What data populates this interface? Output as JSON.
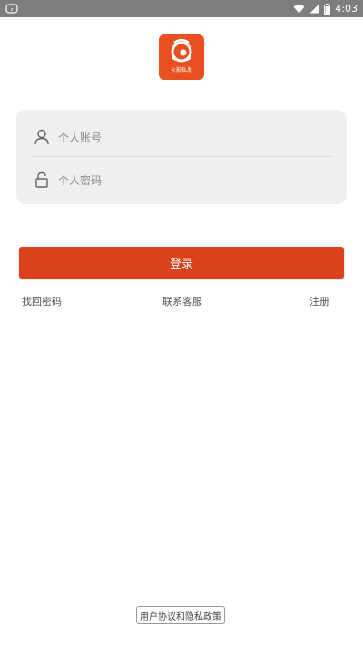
{
  "status_bar": {
    "time": "4:03",
    "icons": [
      "notification-icon",
      "wifi-icon",
      "signal-icon",
      "battery-icon"
    ]
  },
  "logo": {
    "text": "火影私发",
    "color": "#e8501f"
  },
  "form": {
    "account_placeholder": "个人账号",
    "password_placeholder": "个人密码"
  },
  "login_button": {
    "label": "登录",
    "color": "#d9421c"
  },
  "links": {
    "find_password": "找回密码",
    "contact_support": "联系客服",
    "register": "注册"
  },
  "footer": {
    "agreement": "用户协议和隐私政策"
  }
}
